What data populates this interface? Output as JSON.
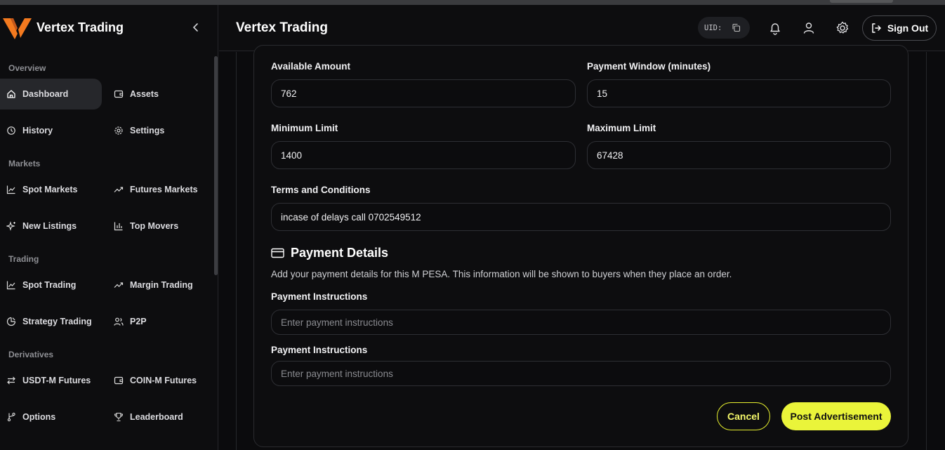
{
  "app": {
    "brand": "Vertex Trading",
    "brand_color": "#f47a1f",
    "accent": "#eaf43a"
  },
  "sidebar": {
    "sections": {
      "overview": "Overview",
      "markets": "Markets",
      "trading": "Trading",
      "derivatives": "Derivatives"
    },
    "items": {
      "dashboard": {
        "label": "Dashboard",
        "icon": "home-icon"
      },
      "assets": {
        "label": "Assets",
        "icon": "wallet-icon"
      },
      "history": {
        "label": "History",
        "icon": "history-icon"
      },
      "settings": {
        "label": "Settings",
        "icon": "gear-icon"
      },
      "spot_markets": {
        "label": "Spot Markets",
        "icon": "line-chart-icon"
      },
      "futures_markets": {
        "label": "Futures Markets",
        "icon": "trending-up-icon"
      },
      "new_listings": {
        "label": "New Listings",
        "icon": "sparkles-icon"
      },
      "top_movers": {
        "label": "Top Movers",
        "icon": "bar-chart-icon"
      },
      "spot_trading": {
        "label": "Spot Trading",
        "icon": "line-chart-icon"
      },
      "margin_trading": {
        "label": "Margin Trading",
        "icon": "trending-up-icon"
      },
      "strategy_trading": {
        "label": "Strategy Trading",
        "icon": "strategy-icon"
      },
      "p2p": {
        "label": "P2P",
        "icon": "users-icon"
      },
      "usdt_futures": {
        "label": "USDT-M Futures",
        "icon": "swap-icon"
      },
      "coin_futures": {
        "label": "COIN-M Futures",
        "icon": "wallet-icon"
      },
      "options": {
        "label": "Options",
        "icon": "branch-icon"
      },
      "leaderboard": {
        "label": "Leaderboard",
        "icon": "trophy-icon"
      }
    }
  },
  "header": {
    "title": "Vertex Trading",
    "uid_label": "UID:",
    "sign_out": "Sign Out"
  },
  "form": {
    "available_amount": {
      "label": "Available Amount",
      "value": "762"
    },
    "payment_window": {
      "label": "Payment Window (minutes)",
      "value": "15"
    },
    "minimum_limit": {
      "label": "Minimum Limit",
      "value": "1400"
    },
    "maximum_limit": {
      "label": "Maximum Limit",
      "value": "67428"
    },
    "terms": {
      "label": "Terms and Conditions",
      "value": "incase of delays call 0702549512"
    }
  },
  "payment_details": {
    "title": "Payment Details",
    "description": "Add your payment details for this M PESA. This information will be shown to buyers when they place an order.",
    "instructions_1": {
      "label": "Payment Instructions",
      "placeholder": "Enter payment instructions"
    },
    "instructions_2": {
      "label": "Payment Instructions",
      "placeholder": "Enter payment instructions"
    }
  },
  "actions": {
    "cancel": "Cancel",
    "post": "Post Advertisement"
  }
}
